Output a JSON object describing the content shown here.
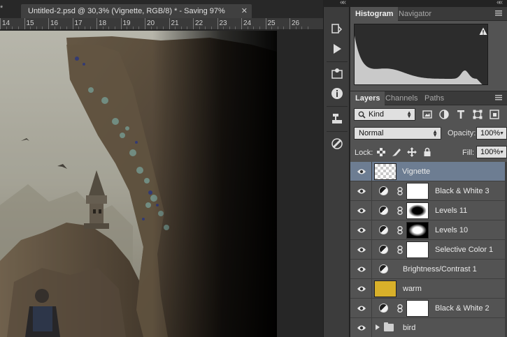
{
  "document": {
    "prev_tab_glyph": "*",
    "tab_title": "Untitled-2.psd @ 30,3% (Vignette, RGB/8) * - Saving 97%",
    "close_glyph": "✕",
    "ruler_labels": [
      "14",
      "15",
      "16",
      "17",
      "18",
      "19",
      "20",
      "21",
      "22",
      "23",
      "24",
      "25",
      "26"
    ]
  },
  "panel_collapse_glyph": "««",
  "histogram_panel": {
    "tabs": [
      {
        "label": "Histogram",
        "active": true
      },
      {
        "label": "Navigator",
        "active": false
      }
    ],
    "warning_icon": "warning-triangle-icon"
  },
  "layers_panel": {
    "tabs": [
      {
        "label": "Layers",
        "active": true
      },
      {
        "label": "Channels",
        "active": false
      },
      {
        "label": "Paths",
        "active": false
      }
    ],
    "filter_kind": "Kind",
    "blend_mode": "Normal",
    "opacity_label": "Opacity:",
    "opacity_value": "100%",
    "lock_label": "Lock:",
    "fill_label": "Fill:",
    "fill_value": "100%",
    "layers": [
      {
        "name": "Vignette",
        "type": "pixel",
        "selected": true
      },
      {
        "name": "Black & White 3",
        "type": "adjustment",
        "mask": "white"
      },
      {
        "name": "Levels 11",
        "type": "adjustment",
        "mask": "black-ellipse"
      },
      {
        "name": "Levels 10",
        "type": "adjustment",
        "mask": "white-ellipse"
      },
      {
        "name": "Selective Color 1",
        "type": "adjustment",
        "mask": "white"
      },
      {
        "name": "Brightness/Contrast 1",
        "type": "adjustment-nomask"
      },
      {
        "name": "warm",
        "type": "fill",
        "color": "#d8b02a"
      },
      {
        "name": "Black & White 2",
        "type": "adjustment",
        "mask": "white"
      },
      {
        "name": "bird",
        "type": "group"
      }
    ]
  },
  "colors": {
    "selected_layer": "#6d7d92",
    "warm_fill": "#d8b02a"
  }
}
